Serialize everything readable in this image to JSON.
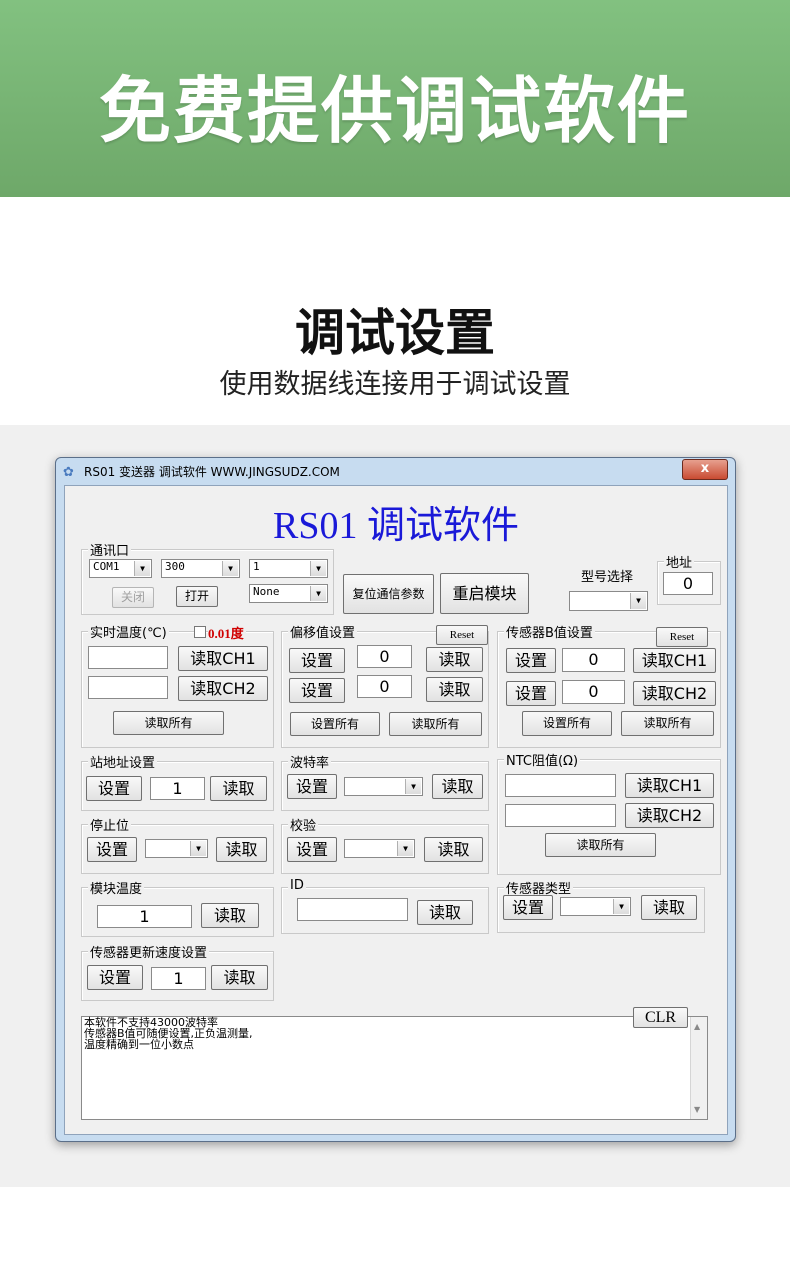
{
  "banner": {
    "title": "免费提供调试软件"
  },
  "section": {
    "title": "调试设置",
    "subtitle": "使用数据线连接用于调试设置"
  },
  "window": {
    "title": "RS01 变送器 调试软件 WWW.JINGSUDZ.COM",
    "close_symbol": "x",
    "app_title": "RS01  调试软件"
  },
  "comm": {
    "label": "通讯口",
    "port": "COM1",
    "baud": "300",
    "addr": "1",
    "parity": "None",
    "close_label": "关闭",
    "open_label": "打开",
    "reset_params_label": "复位通信参数",
    "restart_label": "重启模块"
  },
  "model": {
    "label": "型号选择",
    "value": ""
  },
  "address": {
    "label": "地址",
    "value": "0"
  },
  "realtime": {
    "label": "实时温度(℃)",
    "precision_label": "0.01度",
    "ch1_value": "",
    "ch2_value": "",
    "read_ch1": "读取CH1",
    "read_ch2": "读取CH2",
    "read_all": "读取所有"
  },
  "offset": {
    "label": "偏移值设置",
    "reset": "Reset",
    "set1": "设置",
    "val1": "0",
    "read1": "读取",
    "set2": "设置",
    "val2": "0",
    "read2": "读取",
    "set_all": "设置所有",
    "read_all": "读取所有"
  },
  "bvalue": {
    "label": "传感器B值设置",
    "reset": "Reset",
    "set1": "设置",
    "val1": "0",
    "read1": "读取CH1",
    "set2": "设置",
    "val2": "0",
    "read2": "读取CH2",
    "set_all": "设置所有",
    "read_all": "读取所有"
  },
  "station": {
    "label": "站地址设置",
    "set": "设置",
    "value": "1",
    "read": "读取"
  },
  "baudrate": {
    "label": "波特率",
    "set": "设置",
    "value": "",
    "read": "读取"
  },
  "ntc": {
    "label": "NTC阻值(Ω)",
    "ch1_value": "",
    "ch2_value": "",
    "read_ch1": "读取CH1",
    "read_ch2": "读取CH2",
    "read_all": "读取所有"
  },
  "stopbit": {
    "label": "停止位",
    "set": "设置",
    "value": "",
    "read": "读取"
  },
  "checksum": {
    "label": "校验",
    "set": "设置",
    "value": "",
    "read": "读取"
  },
  "modtemp": {
    "label": "模块温度",
    "value": "1",
    "read": "读取"
  },
  "id": {
    "label": "ID",
    "value": "",
    "read": "读取"
  },
  "sensortype": {
    "label": "传感器类型",
    "set": "设置",
    "value": "",
    "read": "读取"
  },
  "updaterate": {
    "label": "传感器更新速度设置",
    "set": "设置",
    "value": "1",
    "read": "读取"
  },
  "log": {
    "clear_label": "CLR",
    "lines": [
      "本软件不支持43000波特率",
      "传感器B值可随便设置,正负温测量,",
      "温度精确到一位小数点"
    ]
  }
}
